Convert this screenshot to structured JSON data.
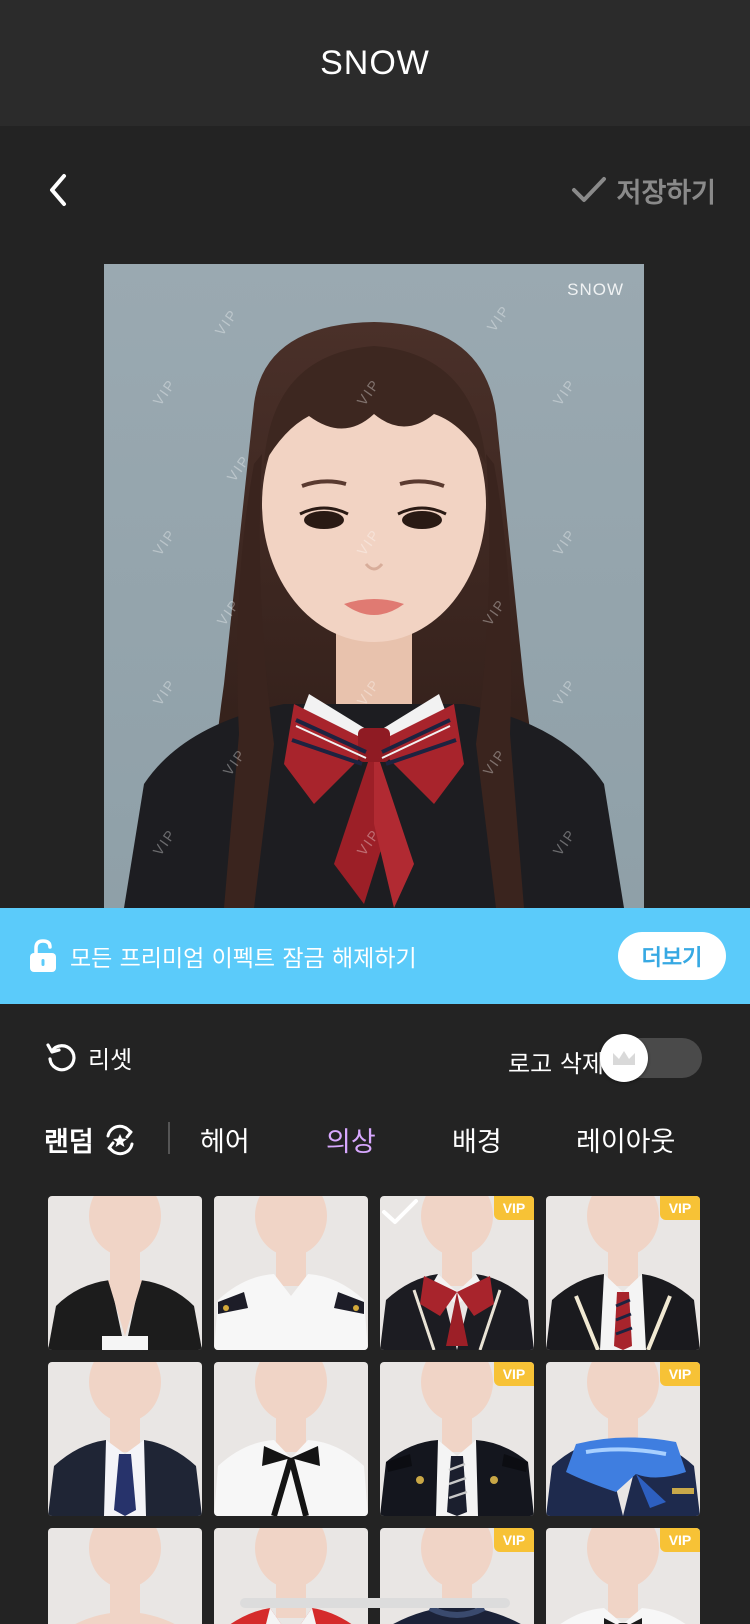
{
  "header": {
    "title": "SNOW"
  },
  "toolbar": {
    "back_icon": "chevron-left-icon",
    "save_label": "저장하기",
    "save_icon": "check-icon",
    "save_color": "#8a8a8a"
  },
  "photo": {
    "watermark_brand": "SNOW",
    "watermark_text": "VIP"
  },
  "promo": {
    "text": "모든 프리미엄 이펙트 잠금 해제하기",
    "button_label": "더보기",
    "background": "#5bcbfa",
    "icon": "unlock-icon"
  },
  "controls": {
    "reset_label": "리셋",
    "reset_icon": "reset-icon",
    "logo_delete_label": "로고 삭제",
    "logo_toggle_on": false,
    "toggle_icon": "crown-icon"
  },
  "tabs": {
    "random_label": "랜덤",
    "random_icon": "shuffle-star-icon",
    "items": [
      {
        "label": "헤어",
        "active": false
      },
      {
        "label": "의상",
        "active": true
      },
      {
        "label": "배경",
        "active": false
      },
      {
        "label": "레이아웃",
        "active": false
      }
    ],
    "active_color": "#d8a8ff"
  },
  "outfits": {
    "vip_label": "VIP",
    "items": [
      {
        "name": "black-blazer",
        "vip": false,
        "selected": false
      },
      {
        "name": "white-uniform-shirt",
        "vip": false,
        "selected": false
      },
      {
        "name": "school-uniform-red-bow",
        "vip": true,
        "selected": true
      },
      {
        "name": "school-uniform-striped-tie",
        "vip": true,
        "selected": false
      },
      {
        "name": "navy-suit-tie",
        "vip": false,
        "selected": false
      },
      {
        "name": "white-shirt-black-ribbon",
        "vip": false,
        "selected": false
      },
      {
        "name": "police-uniform",
        "vip": true,
        "selected": false
      },
      {
        "name": "flight-attendant-scarf",
        "vip": true,
        "selected": false
      },
      {
        "name": "bare-shoulders",
        "vip": false,
        "selected": false
      },
      {
        "name": "red-collar-jacket",
        "vip": false,
        "selected": false
      },
      {
        "name": "navy-jacket",
        "vip": true,
        "selected": false
      },
      {
        "name": "white-shirt-bowtie",
        "vip": true,
        "selected": false
      }
    ]
  }
}
